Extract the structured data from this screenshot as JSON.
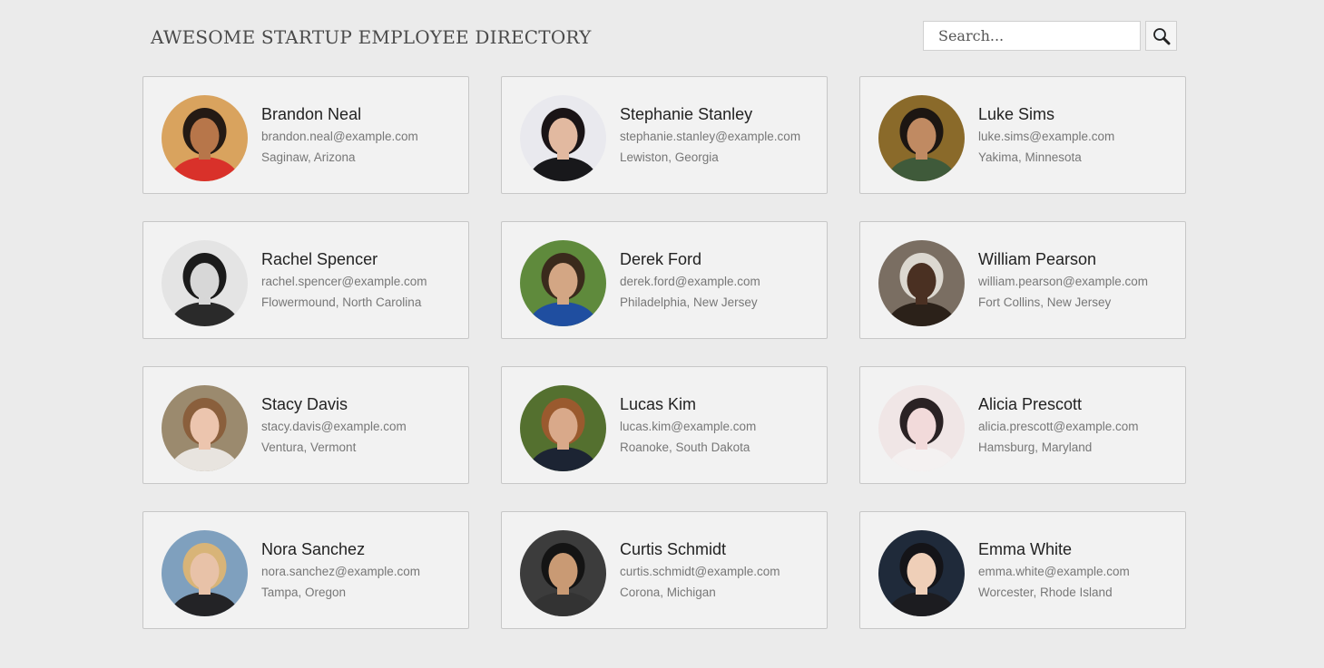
{
  "header": {
    "title": "AWESOME STARTUP EMPLOYEE DIRECTORY",
    "search": {
      "placeholder": "Search...",
      "value": "",
      "button_icon": "search-icon"
    }
  },
  "employees": [
    {
      "name": "Brandon Neal",
      "email": "brandon.neal@example.com",
      "location": "Saginaw, Arizona",
      "avatar_bg": "#d9a35e",
      "avatar_skin": "#b7764a",
      "avatar_hair": "#241a14",
      "avatar_shirt": "#d9312a"
    },
    {
      "name": "Stephanie Stanley",
      "email": "stephanie.stanley@example.com",
      "location": "Lewiston, Georgia",
      "avatar_bg": "#e9e9ee",
      "avatar_skin": "#e2b9a0",
      "avatar_hair": "#1a1416",
      "avatar_shirt": "#18181b"
    },
    {
      "name": "Luke Sims",
      "email": "luke.sims@example.com",
      "location": "Yakima, Minnesota",
      "avatar_bg": "#8a6a2a",
      "avatar_skin": "#c08a62",
      "avatar_hair": "#1c1612",
      "avatar_shirt": "#3f5a3a"
    },
    {
      "name": "Rachel Spencer",
      "email": "rachel.spencer@example.com",
      "location": "Flowermound, North Carolina",
      "avatar_bg": "#e4e4e4",
      "avatar_skin": "#d7d7d7",
      "avatar_hair": "#1b1b1b",
      "avatar_shirt": "#2a2a2a"
    },
    {
      "name": "Derek Ford",
      "email": "derek.ford@example.com",
      "location": "Philadelphia, New Jersey",
      "avatar_bg": "#5f8a3c",
      "avatar_skin": "#d3a684",
      "avatar_hair": "#3a2a1c",
      "avatar_shirt": "#1f4ea0"
    },
    {
      "name": "William Pearson",
      "email": "william.pearson@example.com",
      "location": "Fort Collins, New Jersey",
      "avatar_bg": "#7a6e62",
      "avatar_skin": "#4a3022",
      "avatar_hair": "#dcd8d0",
      "avatar_shirt": "#2b2119"
    },
    {
      "name": "Stacy Davis",
      "email": "stacy.davis@example.com",
      "location": "Ventura, Vermont",
      "avatar_bg": "#9b8a6e",
      "avatar_skin": "#ecc5ae",
      "avatar_hair": "#8a5f3c",
      "avatar_shirt": "#e8e4df"
    },
    {
      "name": "Lucas Kim",
      "email": "lucas.kim@example.com",
      "location": "Roanoke, South Dakota",
      "avatar_bg": "#54702f",
      "avatar_skin": "#d9a98a",
      "avatar_hair": "#9a5a2e",
      "avatar_shirt": "#1c2433"
    },
    {
      "name": "Alicia Prescott",
      "email": "alicia.prescott@example.com",
      "location": "Hamsburg, Maryland",
      "avatar_bg": "#f0e6e6",
      "avatar_skin": "#f2dada",
      "avatar_hair": "#2a2224",
      "avatar_shirt": "#f4f1f1"
    },
    {
      "name": "Nora Sanchez",
      "email": "nora.sanchez@example.com",
      "location": "Tampa, Oregon",
      "avatar_bg": "#7fa0be",
      "avatar_skin": "#e8c2a8",
      "avatar_hair": "#d8b478",
      "avatar_shirt": "#232326"
    },
    {
      "name": "Curtis Schmidt",
      "email": "curtis.schmidt@example.com",
      "location": "Corona, Michigan",
      "avatar_bg": "#3c3c3c",
      "avatar_skin": "#c99a74",
      "avatar_hair": "#141414",
      "avatar_shirt": "#333333"
    },
    {
      "name": "Emma White",
      "email": "emma.white@example.com",
      "location": "Worcester, Rhode Island",
      "avatar_bg": "#1f2a3a",
      "avatar_skin": "#efcfb8",
      "avatar_hair": "#141418",
      "avatar_shirt": "#1c1c20"
    }
  ]
}
